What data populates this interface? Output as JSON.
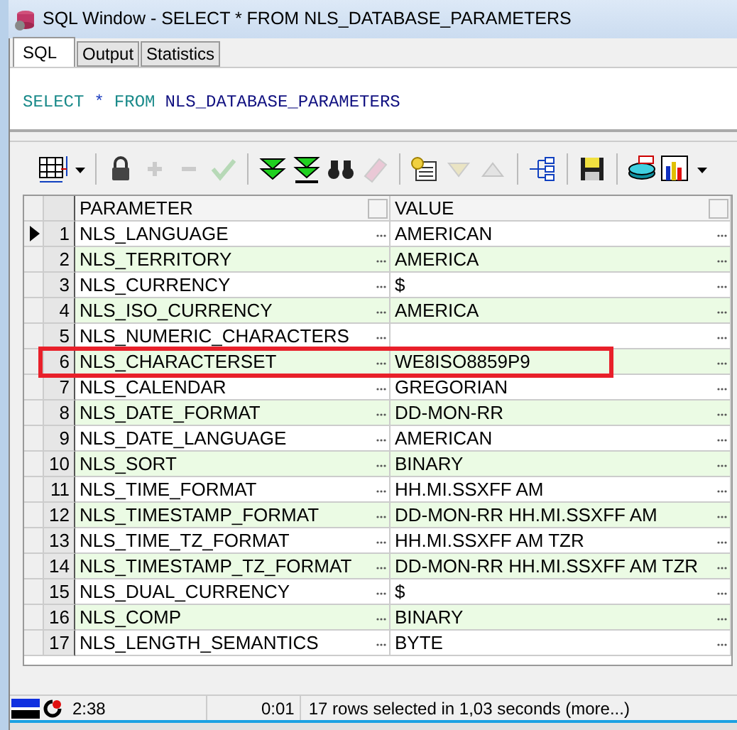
{
  "window": {
    "title": "SQL Window - SELECT * FROM NLS_DATABASE_PARAMETERS"
  },
  "tabs": [
    {
      "label": "SQL",
      "selected": true
    },
    {
      "label": "Output",
      "selected": false
    },
    {
      "label": "Statistics",
      "selected": false
    }
  ],
  "editor": {
    "tokens": [
      {
        "text": "SELECT",
        "kind": "keyword"
      },
      {
        "text": "*",
        "kind": "operator"
      },
      {
        "text": "FROM",
        "kind": "keyword"
      },
      {
        "text": "NLS_DATABASE_PARAMETERS",
        "kind": "identifier"
      }
    ]
  },
  "toolbar": [
    {
      "kind": "grid",
      "disabled": false
    },
    {
      "kind": "lock",
      "disabled": false
    },
    {
      "kind": "plus",
      "disabled": true
    },
    {
      "kind": "minus",
      "disabled": true
    },
    {
      "kind": "check",
      "disabled": true
    },
    {
      "kind": "fetch-next",
      "disabled": false
    },
    {
      "kind": "fetch-last",
      "disabled": false
    },
    {
      "kind": "find",
      "disabled": false
    },
    {
      "kind": "eraser",
      "disabled": true
    },
    {
      "kind": "export",
      "disabled": false
    },
    {
      "kind": "down",
      "disabled": true
    },
    {
      "kind": "up",
      "disabled": true
    },
    {
      "kind": "tree",
      "disabled": false
    },
    {
      "kind": "save",
      "disabled": false
    },
    {
      "kind": "database",
      "disabled": false
    },
    {
      "kind": "chart",
      "disabled": false
    }
  ],
  "table": {
    "columns": [
      "PARAMETER",
      "VALUE"
    ],
    "rows": [
      {
        "number": "1",
        "parameter": "NLS_LANGUAGE",
        "value": "AMERICAN",
        "selected": true,
        "highlighted": false
      },
      {
        "number": "2",
        "parameter": "NLS_TERRITORY",
        "value": "AMERICA",
        "selected": false,
        "highlighted": false
      },
      {
        "number": "3",
        "parameter": "NLS_CURRENCY",
        "value": "$",
        "selected": false,
        "highlighted": false
      },
      {
        "number": "4",
        "parameter": "NLS_ISO_CURRENCY",
        "value": "AMERICA",
        "selected": false,
        "highlighted": false
      },
      {
        "number": "5",
        "parameter": "NLS_NUMERIC_CHARACTERS",
        "selected": false,
        "highlighted": false
      },
      {
        "number": "6",
        "parameter": "NLS_CHARACTERSET",
        "value": "WE8ISO8859P9",
        "selected": false,
        "highlighted": true
      },
      {
        "number": "7",
        "parameter": "NLS_CALENDAR",
        "value": "GREGORIAN",
        "selected": false,
        "highlighted": false
      },
      {
        "number": "8",
        "parameter": "NLS_DATE_FORMAT",
        "value": "DD-MON-RR",
        "selected": false,
        "highlighted": false
      },
      {
        "number": "9",
        "parameter": "NLS_DATE_LANGUAGE",
        "value": "AMERICAN",
        "selected": false,
        "highlighted": false
      },
      {
        "number": "10",
        "parameter": "NLS_SORT",
        "value": "BINARY",
        "selected": false,
        "highlighted": false
      },
      {
        "number": "11",
        "parameter": "NLS_TIME_FORMAT",
        "value": "HH.MI.SSXFF AM",
        "selected": false,
        "highlighted": false
      },
      {
        "number": "12",
        "parameter": "NLS_TIMESTAMP_FORMAT",
        "value": "DD-MON-RR HH.MI.SSXFF AM",
        "selected": false,
        "highlighted": false
      },
      {
        "number": "13",
        "parameter": "NLS_TIME_TZ_FORMAT",
        "value": "HH.MI.SSXFF AM TZR",
        "selected": false,
        "highlighted": false
      },
      {
        "number": "14",
        "parameter": "NLS_TIMESTAMP_TZ_FORMAT",
        "value": "DD-MON-RR HH.MI.SSXFF AM TZR",
        "selected": false,
        "highlighted": false
      },
      {
        "number": "15",
        "parameter": "NLS_DUAL_CURRENCY",
        "value": "$",
        "selected": false,
        "highlighted": false
      },
      {
        "number": "16",
        "parameter": "NLS_COMP",
        "value": "BINARY",
        "selected": false,
        "highlighted": false
      },
      {
        "number": "17",
        "parameter": "NLS_LENGTH_SEMANTICS",
        "value": "BYTE",
        "selected": false,
        "highlighted": false
      }
    ]
  },
  "status_bar": {
    "cursor": "2:38",
    "elapsed": "0:01",
    "message": "17 rows selected in 1,03 seconds (more...)"
  }
}
